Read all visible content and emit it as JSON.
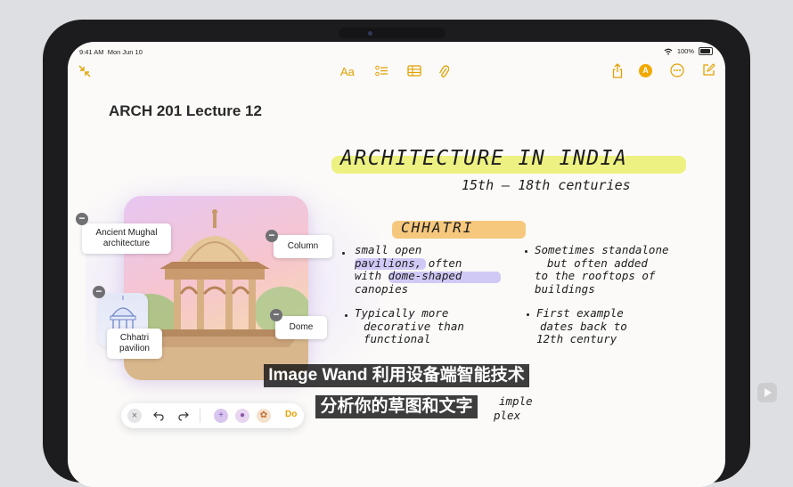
{
  "status_bar": {
    "time": "9:41 AM",
    "date": "Mon Jun 10",
    "battery": "100%"
  },
  "toolbar": {
    "collapse_icon": "collapse-arrows-icon",
    "format_label": "Aa",
    "checklist_icon": "checklist-icon",
    "table_icon": "table-icon",
    "attach_icon": "paperclip-icon",
    "share_icon": "share-icon",
    "avatar_label": "A",
    "more_icon": "ellipsis-icon",
    "compose_icon": "compose-icon"
  },
  "note": {
    "title": "ARCH 201 Lecture 12",
    "handwriting": {
      "heading": "ARCHITECTURE IN INDIA",
      "subheading": "15th – 18th centuries",
      "section": "CHHATRI",
      "col1_b1": [
        "small open",
        "pavilions, often",
        "with dome-shaped",
        "canopies"
      ],
      "col2_b1": [
        "Sometimes standalone",
        "but often added",
        "to the rooftops of",
        "buildings"
      ],
      "col1_b2": [
        "Typically more",
        "decorative than",
        "functional"
      ],
      "col2_b2": [
        "First example",
        "dates back to",
        "12th century"
      ],
      "partial_1": "imple",
      "partial_2": "plex"
    }
  },
  "image_labels": {
    "mughal": "Ancient Mughal architecture",
    "column": "Column",
    "dome": "Dome",
    "pavilion": "Chhatri pavilion"
  },
  "tool_palette": {
    "partial_label": "Do"
  },
  "subtitles": {
    "line1": "Image Wand 利用设备端智能技术",
    "line2": "分析你的草图和文字"
  },
  "colors": {
    "accent": "#E2A100",
    "highlight_yellow": "#E8EE5A",
    "highlight_orange": "#F5BC5F",
    "highlight_purple": "#BEB4F5"
  }
}
